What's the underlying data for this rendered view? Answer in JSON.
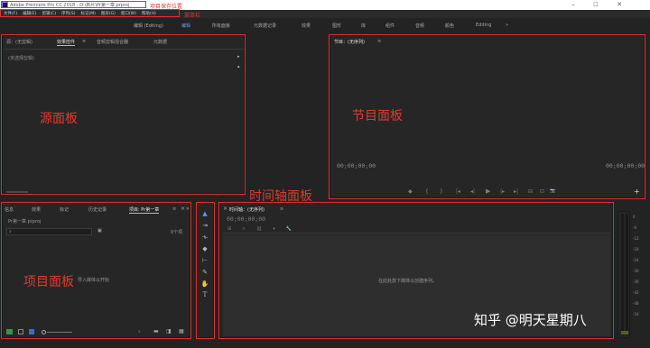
{
  "app": {
    "window_title": "Adobe Premiere Pro CC 2018 - D:\\新片\\Pr第一章.prproj",
    "window_controls": {
      "minimize": "–",
      "maximize": "☐",
      "close": "✕"
    }
  },
  "menu": {
    "items": [
      "文件(F)",
      "编辑(E)",
      "剪辑(C)",
      "序列(S)",
      "标记(M)",
      "图形(G)",
      "窗口(W)",
      "帮助(H)"
    ]
  },
  "workspaces": {
    "tabs": [
      {
        "label": "编辑 (Editing)"
      },
      {
        "label": "编辑",
        "active": true
      },
      {
        "label": "所有面板"
      },
      {
        "label": "元数据记录"
      },
      {
        "label": "效果"
      },
      {
        "label": "图形"
      },
      {
        "label": "库"
      },
      {
        "label": "组件"
      },
      {
        "label": "音频"
      },
      {
        "label": "颜色"
      },
      {
        "label": "Editing"
      }
    ],
    "overflow": "»"
  },
  "source_panel": {
    "tabs": [
      "源：(无剪辑)",
      "效果控件",
      "音频剪辑混合器",
      "元数据"
    ],
    "active_tab": "效果控件",
    "menu_icon": "≡",
    "no_clip_text": "(未选择剪辑)",
    "arrow": "▸"
  },
  "program_panel": {
    "title": "节目：(无序列)",
    "menu_icon": "≡",
    "timecode_left": "00;00;00;00",
    "timecode_right": "00;00;00;00",
    "controls": [
      "◆",
      "{",
      "}",
      "|◂",
      "◂|",
      "▶",
      "|▸",
      "▸|",
      "⊟",
      "⊡",
      "📷"
    ],
    "add_button": "+"
  },
  "project_panel": {
    "tabs": [
      "信息",
      "效果",
      "标记",
      "历史记录",
      "项目: Pr第一章"
    ],
    "active_tab": "项目: Pr第一章",
    "menu_icon": "≡",
    "close_icon": "×",
    "overflow_icon": "»",
    "file_name": "Pr第一章.prproj",
    "item_count": "0个项",
    "empty_hint": "导入媒体以开始"
  },
  "timeline_panel": {
    "title": "时间轴：(无序列)",
    "close_icon": "×",
    "menu_icon": "≡",
    "timecode": "00;00;00;00",
    "empty_hint": "在此处放下媒体以创建序列。"
  },
  "audio_meter": {
    "ticks": [
      "0",
      "-6",
      "-12",
      "-18",
      "-24",
      "-30",
      "-36",
      "-42",
      "-48",
      "-54"
    ]
  },
  "annotations": {
    "project_save_location": "项目保存位置",
    "menu_bar": "菜单栏",
    "source_panel": "源面板",
    "program_panel": "节目面板",
    "timeline_panel": "时间轴面板",
    "project_panel": "项目面板",
    "color": "#e03a2f"
  },
  "watermark": {
    "text": "知乎 @明天星期八"
  }
}
